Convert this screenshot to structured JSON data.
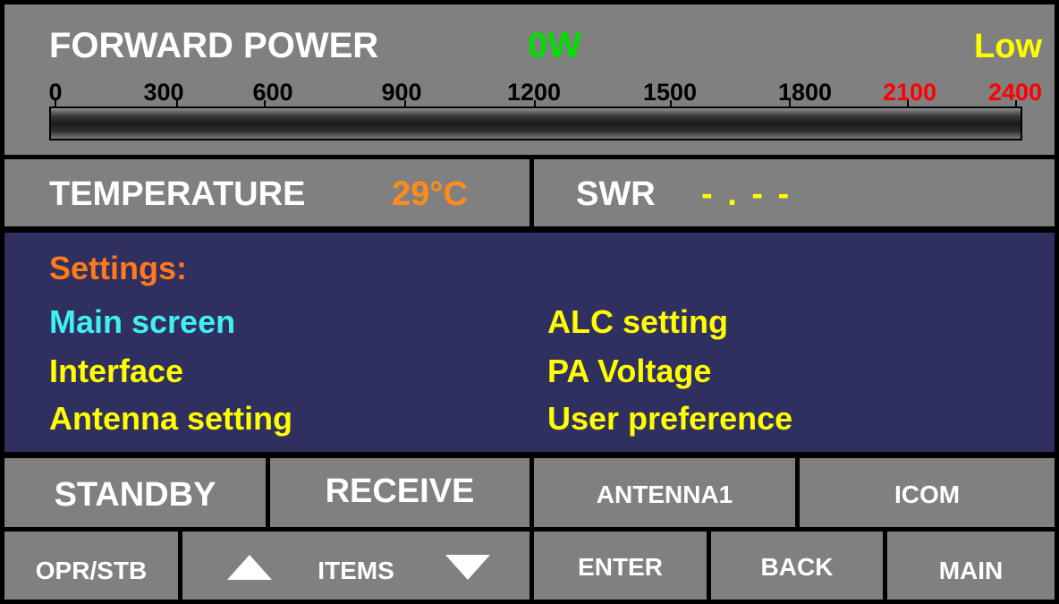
{
  "forward_power": {
    "title": "FORWARD POWER",
    "watts": "0W",
    "power_level": "Low",
    "scale_labels": [
      "0",
      "300",
      "600",
      "900",
      "1200",
      "1500",
      "1800",
      "2100",
      "2400"
    ],
    "scale_max": 2400,
    "bar_value_watts": 0
  },
  "temperature": {
    "label": "TEMPERATURE",
    "value": "29°C"
  },
  "swr": {
    "label": "SWR",
    "value": "- . - -"
  },
  "settings": {
    "title": "Settings:",
    "items": [
      "Main screen",
      "ALC setting",
      "Interface",
      "PA Voltage",
      "Antenna setting",
      "User  preference"
    ],
    "selected_index": 0
  },
  "status": {
    "mode": "STANDBY",
    "rx_state": "RECEIVE",
    "antenna": "ANTENNA1",
    "interface": "ICOM"
  },
  "buttons": {
    "opr_stb": "OPR/STB",
    "items": "ITEMS",
    "enter": "ENTER",
    "back": "BACK",
    "main": "MAIN"
  },
  "colors": {
    "background": "#000000",
    "panel": "#808080",
    "settings_bg": "#2f2f60",
    "watts": "#00e000",
    "level": "#ffff00",
    "temperature_value": "#ff8c1a",
    "menu_selected": "#40f0f0",
    "menu_item": "#ffff00",
    "scale_warning": "#ff0000"
  },
  "icons": [
    "arrow-up-icon",
    "arrow-down-icon"
  ]
}
